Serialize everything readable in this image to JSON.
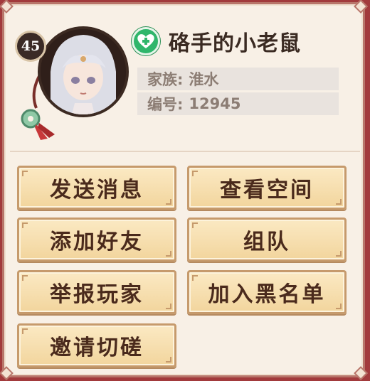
{
  "player": {
    "level": "45",
    "name": "硌手的小老鼠",
    "family_label": "家族:",
    "family_value": "淮水",
    "id_label": "编号:",
    "id_value": "12945"
  },
  "status_icon": "heart-plus-icon",
  "colors": {
    "background": "#a23a3c",
    "panel": "#f8f0e6",
    "button": "#f2d59d",
    "status_green": "#2fb66b"
  },
  "actions": {
    "send_message": "发送消息",
    "view_space": "查看空间",
    "add_friend": "添加好友",
    "team_up": "组队",
    "report_player": "举报玩家",
    "add_blacklist": "加入黑名单",
    "invite_spar": "邀请切磋"
  }
}
